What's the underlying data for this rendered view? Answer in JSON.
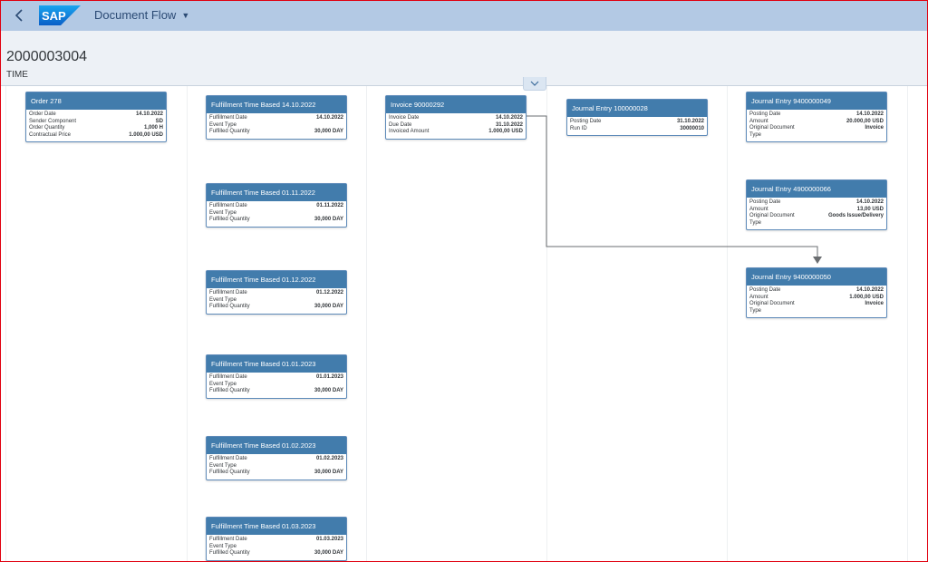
{
  "shell": {
    "app_title": "Document Flow"
  },
  "header": {
    "title": "2000003004",
    "subtitle": "TIME"
  },
  "nodes": {
    "order": {
      "title": "Order 278",
      "rows": [
        {
          "label": "Order Date",
          "value": "14.10.2022"
        },
        {
          "label": "Sender Component",
          "value": "SD"
        },
        {
          "label": "Order Quantity",
          "value": "1,000 H"
        },
        {
          "label": "Contractual Price",
          "value": "1.000,00 USD"
        }
      ]
    },
    "fulfillments": [
      {
        "title": "Fulfillment Time Based 14.10.2022",
        "rows": [
          {
            "label": "Fulfillment Date",
            "value": "14.10.2022"
          },
          {
            "label": "Event Type",
            "value": ""
          },
          {
            "label": "Fulfilled Quantity",
            "value": "30,000 DAY"
          }
        ]
      },
      {
        "title": "Fulfillment Time Based 01.11.2022",
        "rows": [
          {
            "label": "Fulfillment Date",
            "value": "01.11.2022"
          },
          {
            "label": "Event Type",
            "value": ""
          },
          {
            "label": "Fulfilled Quantity",
            "value": "30,000 DAY"
          }
        ]
      },
      {
        "title": "Fulfillment Time Based 01.12.2022",
        "rows": [
          {
            "label": "Fulfillment Date",
            "value": "01.12.2022"
          },
          {
            "label": "Event Type",
            "value": ""
          },
          {
            "label": "Fulfilled Quantity",
            "value": "30,000 DAY"
          }
        ]
      },
      {
        "title": "Fulfillment Time Based 01.01.2023",
        "rows": [
          {
            "label": "Fulfillment Date",
            "value": "01.01.2023"
          },
          {
            "label": "Event Type",
            "value": ""
          },
          {
            "label": "Fulfilled Quantity",
            "value": "30,000 DAY"
          }
        ]
      },
      {
        "title": "Fulfillment Time Based 01.02.2023",
        "rows": [
          {
            "label": "Fulfillment Date",
            "value": "01.02.2023"
          },
          {
            "label": "Event Type",
            "value": ""
          },
          {
            "label": "Fulfilled Quantity",
            "value": "30,000 DAY"
          }
        ]
      },
      {
        "title": "Fulfillment Time Based 01.03.2023",
        "rows": [
          {
            "label": "Fulfillment Date",
            "value": "01.03.2023"
          },
          {
            "label": "Event Type",
            "value": ""
          },
          {
            "label": "Fulfilled Quantity",
            "value": "30,000 DAY"
          }
        ]
      }
    ],
    "invoice": {
      "title": "Invoice 90000292",
      "rows": [
        {
          "label": "Invoice Date",
          "value": "14.10.2022"
        },
        {
          "label": "Due Date",
          "value": "31.10.2022"
        },
        {
          "label": "Invoiced Amount",
          "value": "1.000,00 USD"
        }
      ]
    },
    "journal_100": {
      "title": "Journal Entry 100000028",
      "rows": [
        {
          "label": "Posting Date",
          "value": "31.10.2022"
        },
        {
          "label": "Run ID",
          "value": "30000010"
        }
      ]
    },
    "journal_049": {
      "title": "Journal Entry 9400000049",
      "rows": [
        {
          "label": "Posting Date",
          "value": "14.10.2022"
        },
        {
          "label": "Amount",
          "value": "20.000,00 USD"
        },
        {
          "label": "Original Document",
          "value": "Invoice"
        },
        {
          "label": "Type",
          "value": ""
        }
      ]
    },
    "journal_066": {
      "title": "Journal Entry 4900000066",
      "rows": [
        {
          "label": "Posting Date",
          "value": "14.10.2022"
        },
        {
          "label": "Amount",
          "value": "13,00 USD"
        },
        {
          "label": "Original Document",
          "value": "Goods Issue/Delivery"
        },
        {
          "label": "Type",
          "value": ""
        }
      ]
    },
    "journal_050": {
      "title": "Journal Entry 9400000050",
      "rows": [
        {
          "label": "Posting Date",
          "value": "14.10.2022"
        },
        {
          "label": "Amount",
          "value": "1.000,00 USD"
        },
        {
          "label": "Original Document",
          "value": "Invoice"
        },
        {
          "label": "Type",
          "value": ""
        }
      ]
    }
  }
}
